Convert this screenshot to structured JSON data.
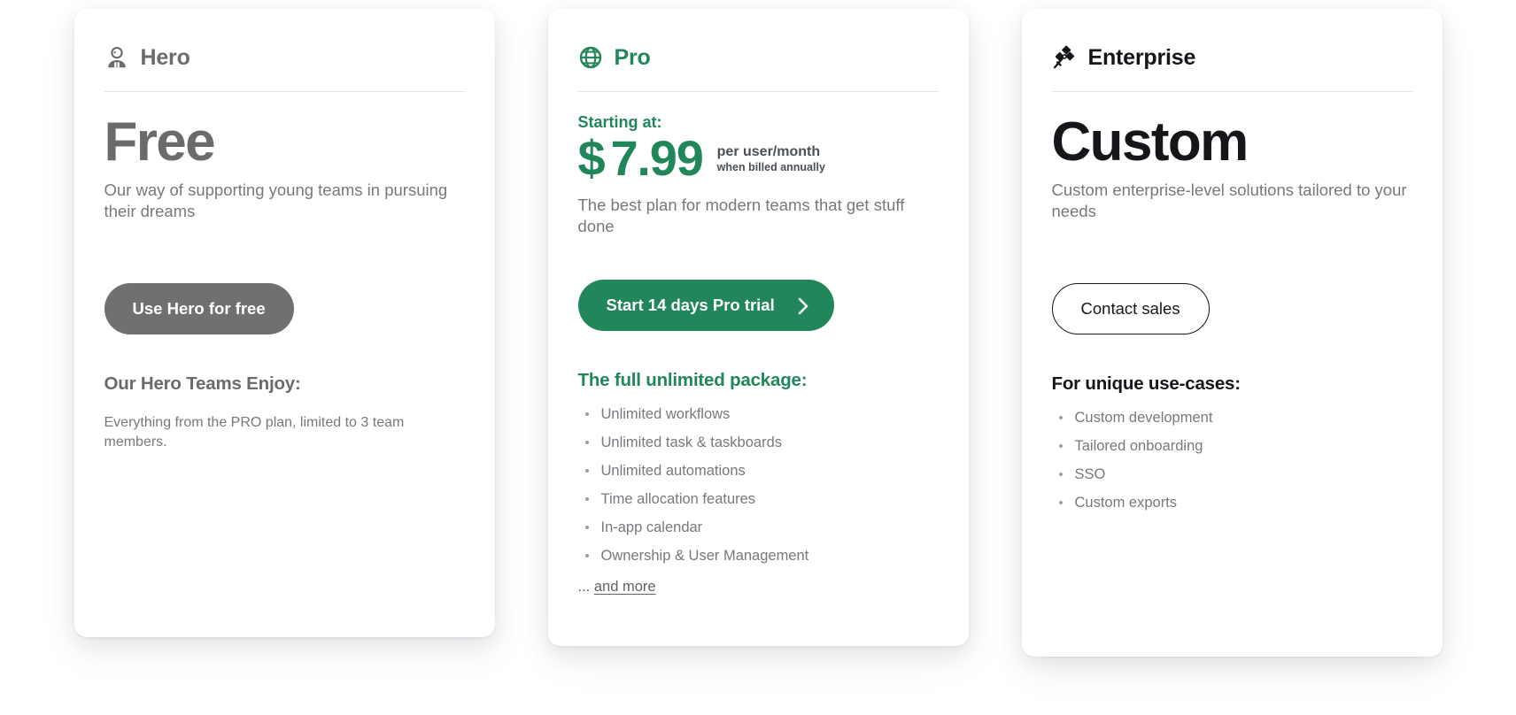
{
  "page": {
    "background": "#ffffff"
  },
  "colors": {
    "green": "#21865a",
    "gray": "#6b6b6b",
    "dark": "#15161a",
    "body_text": "#76797d",
    "rule": "#e3e4e6"
  },
  "plans": [
    {
      "id": "hero",
      "icon_name": "hero-person-icon",
      "name": "Hero",
      "price_headline": "Free",
      "starting_at_label": "",
      "price_currency": "",
      "price_amount": "",
      "price_unit": "",
      "price_billing": "",
      "description": "Our way of supporting young teams in pursuing their dreams",
      "cta_label": "Use Hero for free",
      "cta_has_arrow": false,
      "features_title": "Our Hero Teams Enjoy:",
      "simple_note": "Everything from the PRO plan, limited to 3 team members.",
      "features": [],
      "more_ellipsis": "",
      "more_link": ""
    },
    {
      "id": "pro",
      "icon_name": "globe-icon",
      "name": "Pro",
      "price_headline": "",
      "starting_at_label": "Starting at:",
      "price_currency": "$",
      "price_amount": "7.99",
      "price_unit": "per user/month",
      "price_billing": "when billed annually",
      "description": "The best plan for modern teams that get stuff done",
      "cta_label": "Start 14 days Pro trial",
      "cta_has_arrow": true,
      "features_title": "The full unlimited package:",
      "simple_note": "",
      "features": [
        "Unlimited workflows",
        "Unlimited task & taskboards",
        "Unlimited automations",
        "Time allocation features",
        "In-app calendar",
        "Ownership & User Management"
      ],
      "more_ellipsis": "...",
      "more_link": "and more"
    },
    {
      "id": "enterprise",
      "icon_name": "satellite-icon",
      "name": "Enterprise",
      "price_headline": "Custom",
      "starting_at_label": "",
      "price_currency": "",
      "price_amount": "",
      "price_unit": "",
      "price_billing": "",
      "description": "Custom enterprise-level solutions tailored to your needs",
      "cta_label": "Contact sales",
      "cta_has_arrow": false,
      "features_title": "For unique use-cases:",
      "simple_note": "",
      "features": [
        "Custom development",
        "Tailored onboarding",
        "SSO",
        "Custom exports"
      ],
      "more_ellipsis": "",
      "more_link": ""
    }
  ]
}
